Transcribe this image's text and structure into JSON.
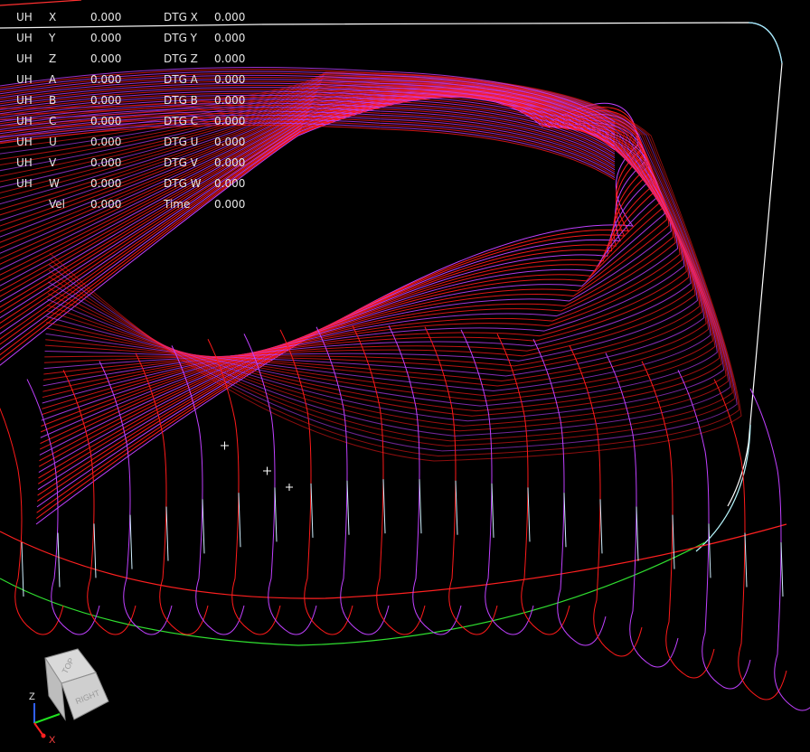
{
  "dro": {
    "rows": [
      {
        "prefix": "UH",
        "axis": "X",
        "value": "0.000",
        "dtg_label": "DTG X",
        "dtg_value": "0.000"
      },
      {
        "prefix": "UH",
        "axis": "Y",
        "value": "0.000",
        "dtg_label": "DTG Y",
        "dtg_value": "0.000"
      },
      {
        "prefix": "UH",
        "axis": "Z",
        "value": "0.000",
        "dtg_label": "DTG Z",
        "dtg_value": "0.000"
      },
      {
        "prefix": "UH",
        "axis": "A",
        "value": "0.000",
        "dtg_label": "DTG A",
        "dtg_value": "0.000"
      },
      {
        "prefix": "UH",
        "axis": "B",
        "value": "0.000",
        "dtg_label": "DTG B",
        "dtg_value": "0.000"
      },
      {
        "prefix": "UH",
        "axis": "C",
        "value": "0.000",
        "dtg_label": "DTG C",
        "dtg_value": "0.000"
      },
      {
        "prefix": "UH",
        "axis": "U",
        "value": "0.000",
        "dtg_label": "DTG U",
        "dtg_value": "0.000"
      },
      {
        "prefix": "UH",
        "axis": "V",
        "value": "0.000",
        "dtg_label": "DTG V",
        "dtg_value": "0.000"
      },
      {
        "prefix": "UH",
        "axis": "W",
        "value": "0.000",
        "dtg_label": "DTG W",
        "dtg_value": "0.000"
      }
    ],
    "vel": {
      "label": "Vel",
      "value": "0.000",
      "time_label": "Time",
      "time_value": "0.000"
    }
  },
  "view_cube": {
    "top": "TOP",
    "right": "RIGHT"
  },
  "axis_triad": {
    "z": "Z",
    "x": "X"
  },
  "colors": {
    "background": "#000000",
    "toolpath_feed": "#ff1a1a",
    "toolpath_arc": "#c040ff",
    "toolpath_rapid": "#d0f0ff",
    "limit_box": "#e8fff4",
    "stock_outline": "#30e030",
    "triad_x": "#ff2020",
    "triad_y": "#20e020",
    "triad_z": "#3060ff"
  }
}
